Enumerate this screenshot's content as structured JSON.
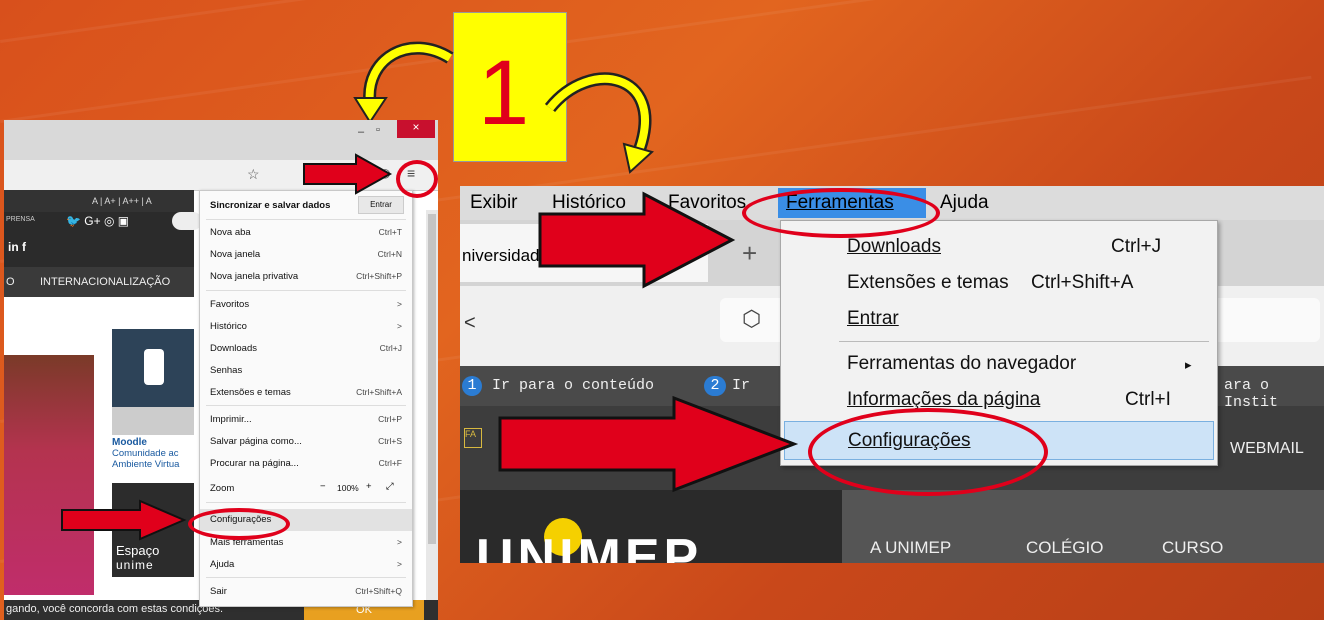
{
  "step_number": "1",
  "left_window": {
    "topbar_text": "A |  A+ |  A++ |  A",
    "press_text": "PRENSA",
    "nav_item": "INTERNACIONALIZAÇÃO",
    "nav_prefix": "O",
    "moodle_title": "Moodle",
    "moodle_sub1": "Comunidade ac",
    "moodle_sub2": "Ambiente Virtua",
    "espaco_text": "Espaço",
    "unimep_small": "unime",
    "cookie_text": "gando, você concorda com estas condições.",
    "cookie_button": "OK",
    "menu": {
      "sync_label": "Sincronizar e salvar dados",
      "sync_button": "Entrar",
      "items": [
        {
          "label": "Nova aba",
          "shortcut": "Ctrl+T"
        },
        {
          "label": "Nova janela",
          "shortcut": "Ctrl+N"
        },
        {
          "label": "Nova janela privativa",
          "shortcut": "Ctrl+Shift+P"
        },
        {
          "label": "Favoritos",
          "shortcut": ">"
        },
        {
          "label": "Histórico",
          "shortcut": ">"
        },
        {
          "label": "Downloads",
          "shortcut": "Ctrl+J"
        },
        {
          "label": "Senhas",
          "shortcut": ""
        },
        {
          "label": "Extensões e temas",
          "shortcut": "Ctrl+Shift+A"
        },
        {
          "label": "Imprimir...",
          "shortcut": "Ctrl+P"
        },
        {
          "label": "Salvar página como...",
          "shortcut": "Ctrl+S"
        },
        {
          "label": "Procurar na página...",
          "shortcut": "Ctrl+F"
        },
        {
          "label": "Zoom",
          "shortcut": ""
        },
        {
          "label": "Configurações",
          "shortcut": ""
        },
        {
          "label": "Mais ferramentas",
          "shortcut": ">"
        },
        {
          "label": "Ajuda",
          "shortcut": ">"
        },
        {
          "label": "Sair",
          "shortcut": "Ctrl+Shift+Q"
        }
      ],
      "zoom_minus": "−",
      "zoom_value": "100%",
      "zoom_plus": "+",
      "zoom_expand": "⤢"
    }
  },
  "right_window": {
    "menubar": [
      "Exibir",
      "Histórico",
      "Favoritos",
      "Ferramentas",
      "Ajuda"
    ],
    "tab_title": "niversidade Metodis",
    "tab_close": "×",
    "new_tab": "+",
    "back": "<",
    "skip_link_1_num": "1",
    "skip_link_1": "Ir para o conteúdo",
    "skip_link_2_num": "2",
    "skip_link_2": "Ir",
    "skip_right": "ara o Instit",
    "webmail": "WEBMAIL",
    "nav": [
      "A UNIMEP",
      "COLÉGIO",
      "CURSO"
    ],
    "logo_text": "UNIMEP",
    "dropdown": [
      {
        "label": "Downloads",
        "shortcut": "Ctrl+J"
      },
      {
        "label": "Extensões e temas",
        "shortcut": "Ctrl+Shift+A"
      },
      {
        "label": "Entrar",
        "shortcut": ""
      },
      {
        "label": "Ferramentas do navegador",
        "shortcut": "▸"
      },
      {
        "label": "Informações da página",
        "shortcut": "Ctrl+I"
      },
      {
        "label": "Configurações",
        "shortcut": ""
      }
    ]
  },
  "colors": {
    "accent_red": "#e0001b",
    "highlight_yellow": "#ffff00",
    "background_orange": "#d8501c"
  }
}
